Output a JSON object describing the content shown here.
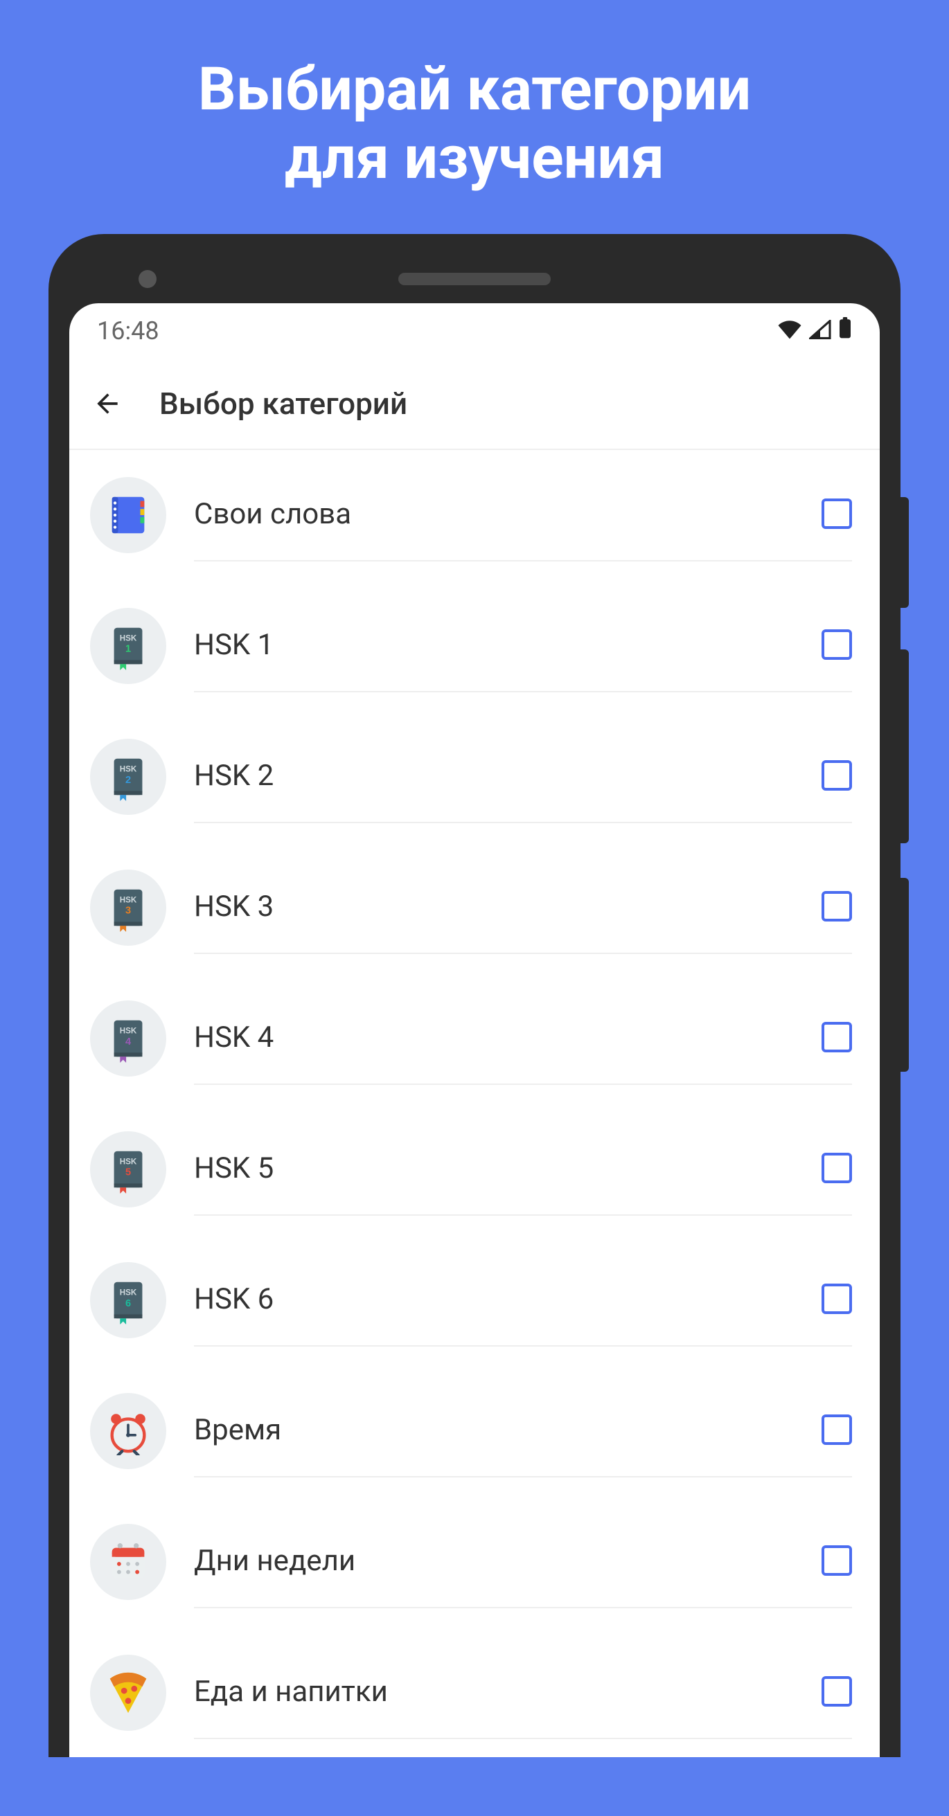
{
  "promo": {
    "line1": "Выбирай категории",
    "line2": "для изучения"
  },
  "status_bar": {
    "time": "16:48"
  },
  "app_bar": {
    "title": "Выбор категорий"
  },
  "categories": [
    {
      "id": "own-words",
      "label": "Свои слова",
      "icon": "notebook",
      "checked": false
    },
    {
      "id": "hsk1",
      "label": "HSK 1",
      "icon": "book-hsk",
      "icon_label": "HSK",
      "icon_num": "1",
      "bookmark": "#2ecc71",
      "checked": false
    },
    {
      "id": "hsk2",
      "label": "HSK 2",
      "icon": "book-hsk",
      "icon_label": "HSK",
      "icon_num": "2",
      "bookmark": "#3498db",
      "checked": false
    },
    {
      "id": "hsk3",
      "label": "HSK 3",
      "icon": "book-hsk",
      "icon_label": "HSK",
      "icon_num": "3",
      "bookmark": "#e67e22",
      "checked": false
    },
    {
      "id": "hsk4",
      "label": "HSK 4",
      "icon": "book-hsk",
      "icon_label": "HSK",
      "icon_num": "4",
      "bookmark": "#9b59b6",
      "checked": false
    },
    {
      "id": "hsk5",
      "label": "HSK 5",
      "icon": "book-hsk",
      "icon_label": "HSK",
      "icon_num": "5",
      "bookmark": "#e74c3c",
      "checked": false
    },
    {
      "id": "hsk6",
      "label": "HSK 6",
      "icon": "book-hsk",
      "icon_label": "HSK",
      "icon_num": "6",
      "bookmark": "#1abc9c",
      "checked": false
    },
    {
      "id": "time",
      "label": "Время",
      "icon": "clock",
      "checked": false
    },
    {
      "id": "weekdays",
      "label": "Дни недели",
      "icon": "calendar",
      "checked": false
    },
    {
      "id": "food-drinks",
      "label": "Еда и напитки",
      "icon": "pizza",
      "checked": false
    }
  ]
}
